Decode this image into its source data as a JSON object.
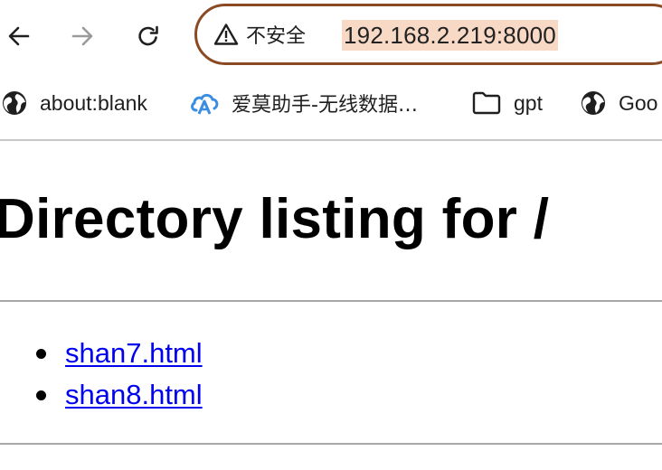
{
  "browser": {
    "security_label": "不安全",
    "url": "192.168.2.219:8000",
    "omnibox_border_color": "#8a4b24",
    "url_highlight_color": "#f8d9c6"
  },
  "bookmarks": [
    {
      "label": "about:blank",
      "icon": "globe-icon"
    },
    {
      "label": "爱莫助手-无线数据…",
      "icon": "cloud-logo-icon"
    },
    {
      "label": "gpt",
      "icon": "folder-icon"
    },
    {
      "label": "Goo",
      "icon": "globe-icon"
    }
  ],
  "page": {
    "title": "Directory listing for /",
    "files": [
      {
        "name": "shan7.html"
      },
      {
        "name": "shan8.html"
      }
    ],
    "link_color": "#0000ee"
  }
}
